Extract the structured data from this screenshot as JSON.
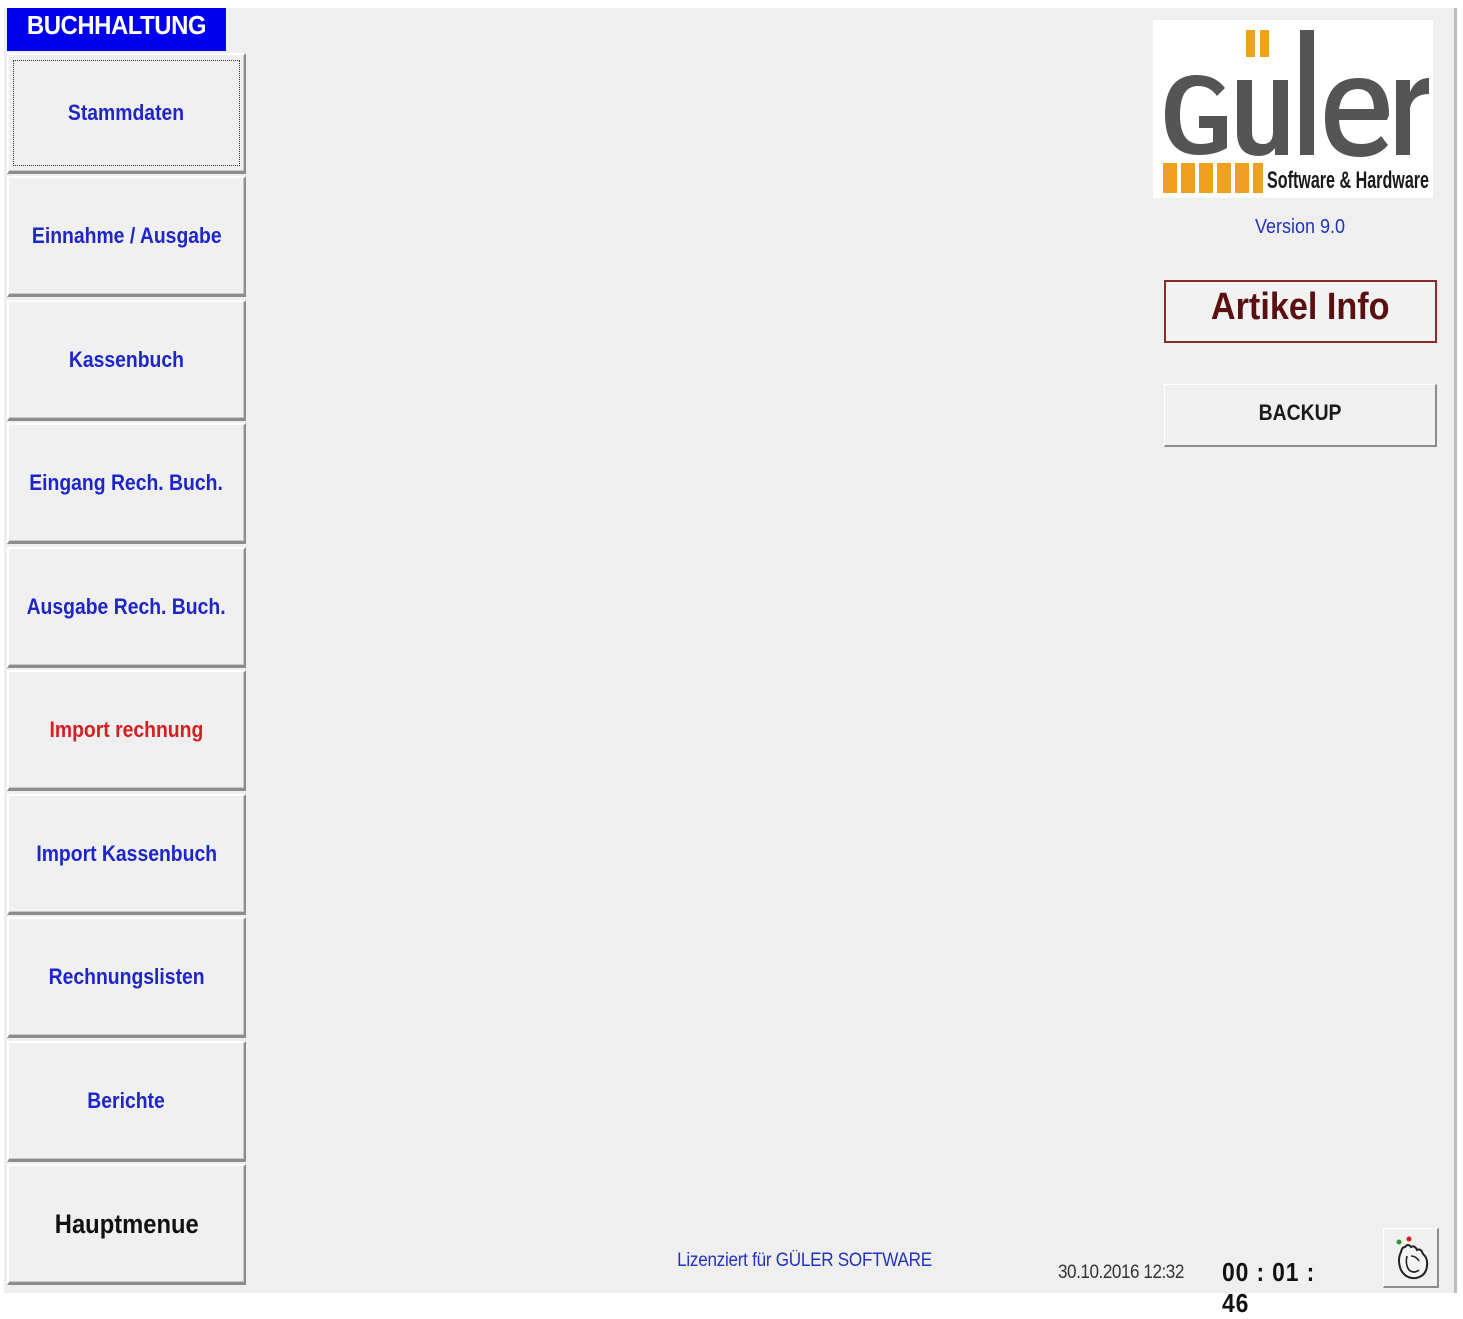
{
  "sidebar": {
    "header": "BUCHHALTUNG",
    "items": [
      {
        "label": "Stammdaten"
      },
      {
        "label": "Einnahme / Ausgabe"
      },
      {
        "label": "Kassenbuch"
      },
      {
        "label": "Eingang Rech. Buch."
      },
      {
        "label": "Ausgabe Rech. Buch."
      },
      {
        "label": "Import rechnung"
      },
      {
        "label": "Import Kassenbuch"
      },
      {
        "label": "Rechnungslisten"
      },
      {
        "label": "Berichte"
      },
      {
        "label": "Hauptmenue"
      }
    ]
  },
  "logo": {
    "brand": "Güler",
    "tagline": "Software & Hardware"
  },
  "version": "Version 9.0",
  "artikel_info": "Artikel Info",
  "backup": "BACKUP",
  "footer": {
    "license": "Lizenziert für GÜLER SOFTWARE",
    "datetime": "30.10.2016 12:32",
    "timer": "00 : 01 : 46"
  },
  "colors": {
    "header_bg": "#0000ee",
    "nav_text": "#1f26c8",
    "nav_text_alert": "#d42020",
    "logo_orange": "#f0a020",
    "logo_gray": "#555555"
  },
  "icons": {
    "exit": "hand-exit-icon"
  }
}
